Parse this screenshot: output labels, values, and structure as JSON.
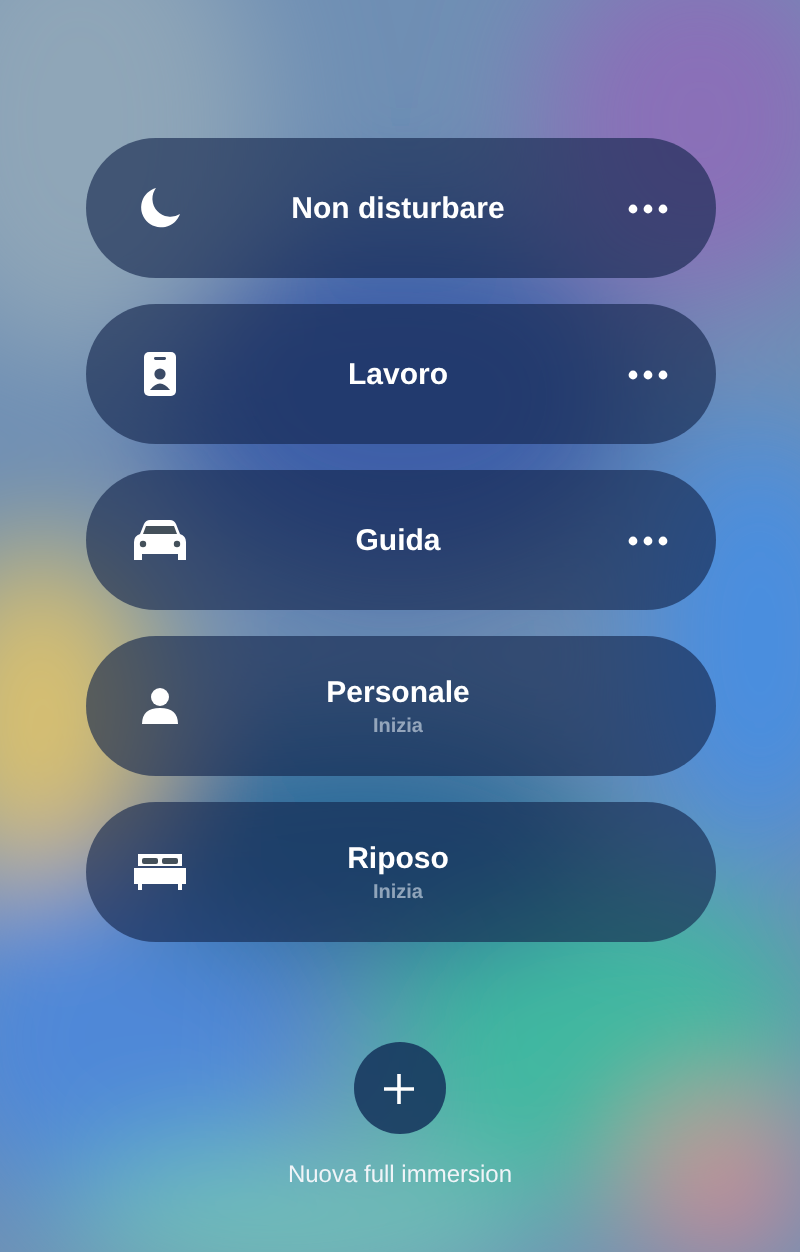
{
  "focus_modes": [
    {
      "kind": "moon",
      "name": "Non disturbare",
      "more": true
    },
    {
      "kind": "badge",
      "name": "Lavoro",
      "more": true
    },
    {
      "kind": "car",
      "name": "Guida",
      "more": true
    },
    {
      "kind": "person",
      "name": "Personale",
      "status": "Inizia",
      "more": false
    },
    {
      "kind": "bed",
      "name": "Riposo",
      "status": "Inizia",
      "more": false
    }
  ],
  "add": {
    "label": "Nuova full immersion"
  }
}
